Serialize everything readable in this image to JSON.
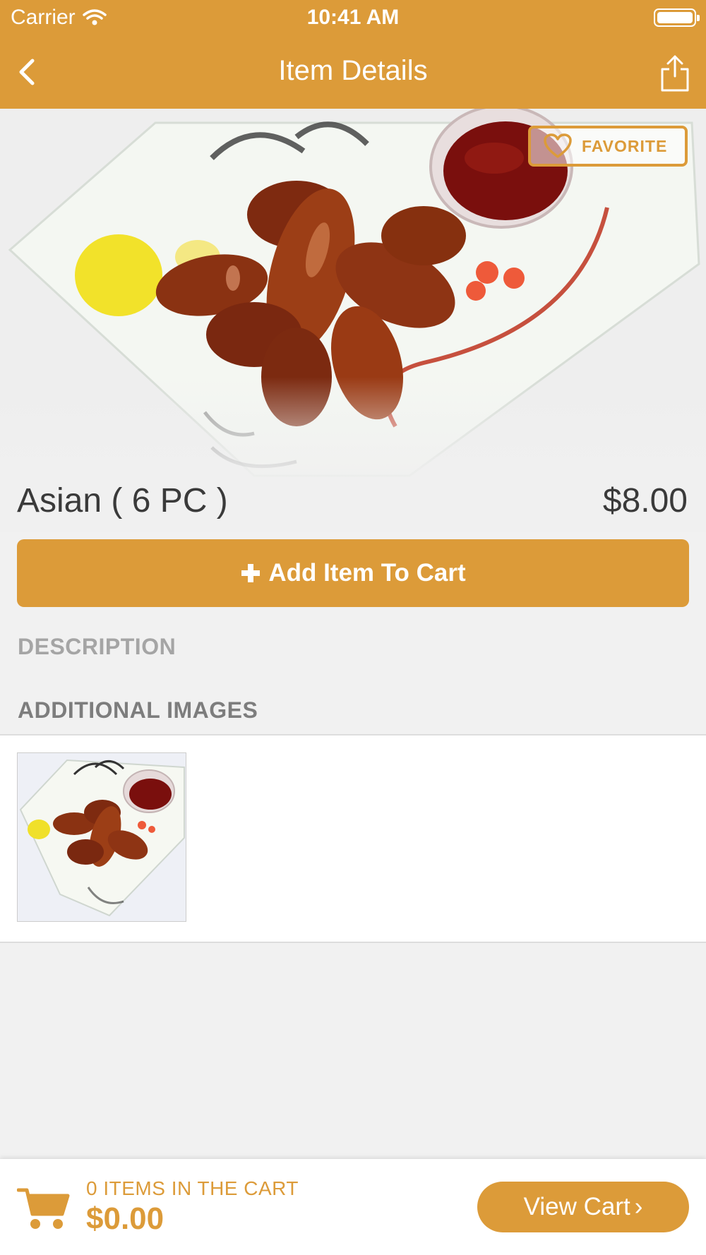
{
  "status_bar": {
    "carrier": "Carrier",
    "time": "10:41 AM"
  },
  "nav": {
    "title": "Item Details",
    "back_icon": "chevron-left-icon",
    "share_icon": "share-icon"
  },
  "item": {
    "name": "Asian ( 6 PC  )",
    "price": "$8.00",
    "favorite_label": "FAVORITE",
    "favorite_icon": "heart-icon",
    "add_to_cart_label": "Add Item To Cart",
    "add_icon": "plus-icon"
  },
  "sections": {
    "description_label": "DESCRIPTION",
    "additional_images_label": "ADDITIONAL IMAGES"
  },
  "cart_bar": {
    "count_text": "0 ITEMS IN THE CART",
    "total": "$0.00",
    "view_cart_label": "View Cart",
    "view_cart_chevron": "›",
    "cart_icon": "shopping-cart-icon"
  },
  "colors": {
    "accent": "#dc9b39",
    "background": "#f1f1f1",
    "label_gray": "#8b8b8b"
  }
}
